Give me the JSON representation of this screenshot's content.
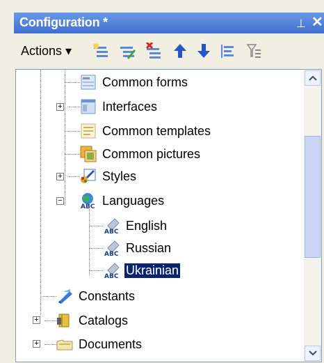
{
  "window": {
    "title": "Configuration *"
  },
  "toolbar": {
    "actions_label": "Actions ▾"
  },
  "tree": {
    "items": [
      {
        "label": "Common forms"
      },
      {
        "label": "Interfaces"
      },
      {
        "label": "Common templates"
      },
      {
        "label": "Common pictures"
      },
      {
        "label": "Styles"
      },
      {
        "label": "Languages"
      },
      {
        "label": "English"
      },
      {
        "label": "Russian"
      },
      {
        "label": "Ukrainian"
      },
      {
        "label": "Constants"
      },
      {
        "label": "Catalogs"
      },
      {
        "label": "Documents"
      }
    ]
  }
}
